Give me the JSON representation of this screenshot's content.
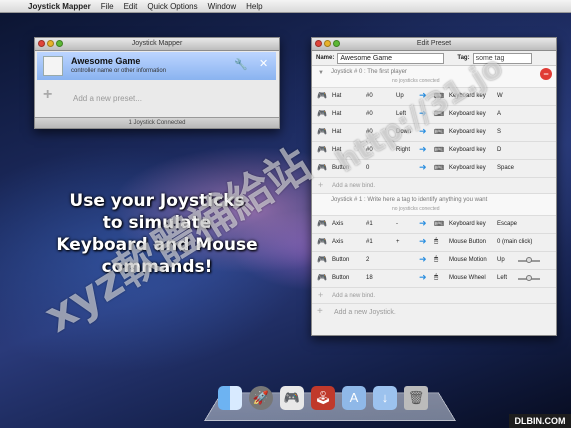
{
  "menubar": {
    "apple": "",
    "app_name": "Joystick Mapper",
    "items": [
      "File",
      "Edit",
      "Quick Options",
      "Window",
      "Help"
    ]
  },
  "mapper_window": {
    "title": "Joystick Mapper",
    "preset": {
      "name": "Awesome Game",
      "subtitle": "controller name or other information"
    },
    "add_preset_label": "Add a new preset...",
    "status": "1 Joystick Connected"
  },
  "edit_window": {
    "title": "Edit Preset",
    "name_label": "Name:",
    "name_value": "Awesome Game",
    "tag_label": "Tag:",
    "tag_value": "some tag",
    "joysticks": [
      {
        "header": "Joystick # 0 : The first player",
        "status": "no joysticks conected",
        "binds": [
          {
            "type": "Hat",
            "num": "#0",
            "dir": "Up",
            "action": "Keyboard key",
            "key": "W",
            "slider": false
          },
          {
            "type": "Hat",
            "num": "#0",
            "dir": "Left",
            "action": "Keyboard key",
            "key": "A",
            "slider": false
          },
          {
            "type": "Hat",
            "num": "#0",
            "dir": "Down",
            "action": "Keyboard key",
            "key": "S",
            "slider": false
          },
          {
            "type": "Hat",
            "num": "#0",
            "dir": "Right",
            "action": "Keyboard key",
            "key": "D",
            "slider": false
          },
          {
            "type": "Button",
            "num": "0",
            "dir": "",
            "action": "Keyboard key",
            "key": "Space",
            "slider": false
          }
        ],
        "add_bind": "Add a new bind."
      },
      {
        "header": "Joystick # 1 : Write here a tag to identify anything you want",
        "status": "no joysticks conected",
        "binds": [
          {
            "type": "Axis",
            "num": "#1",
            "dir": "-",
            "action": "Keyboard key",
            "key": "Escape",
            "slider": false
          },
          {
            "type": "Axis",
            "num": "#1",
            "dir": "+",
            "action": "Mouse Button",
            "key": "0 (main click)",
            "slider": false
          },
          {
            "type": "Button",
            "num": "2",
            "dir": "",
            "action": "Mouse Motion",
            "key": "Up",
            "slider": true
          },
          {
            "type": "Button",
            "num": "18",
            "dir": "",
            "action": "Mouse Wheel",
            "key": "Left",
            "slider": true
          }
        ],
        "add_bind": "Add a new bind."
      }
    ],
    "add_joystick": "Add a new Joystick."
  },
  "promo_lines": [
    "Use your Joysticks",
    "to simulate",
    "Keyboard and Mouse",
    "commands!"
  ],
  "watermark": {
    "line1": "xyz軟體補給站",
    "line2": "http://31.jo"
  },
  "corner_badge": "DLBIN.COM",
  "colors": {
    "selection_blue": "#9dbff5",
    "arrow_blue": "#2a8fe0",
    "remove_red": "#e03b35"
  },
  "icons": [
    "apple-icon",
    "wrench-icon",
    "close-icon",
    "plus-icon",
    "gamepad-icon",
    "keyboard-icon",
    "mouse-icon",
    "arrow-right-icon",
    "minus-icon",
    "disclosure-triangle-icon"
  ]
}
